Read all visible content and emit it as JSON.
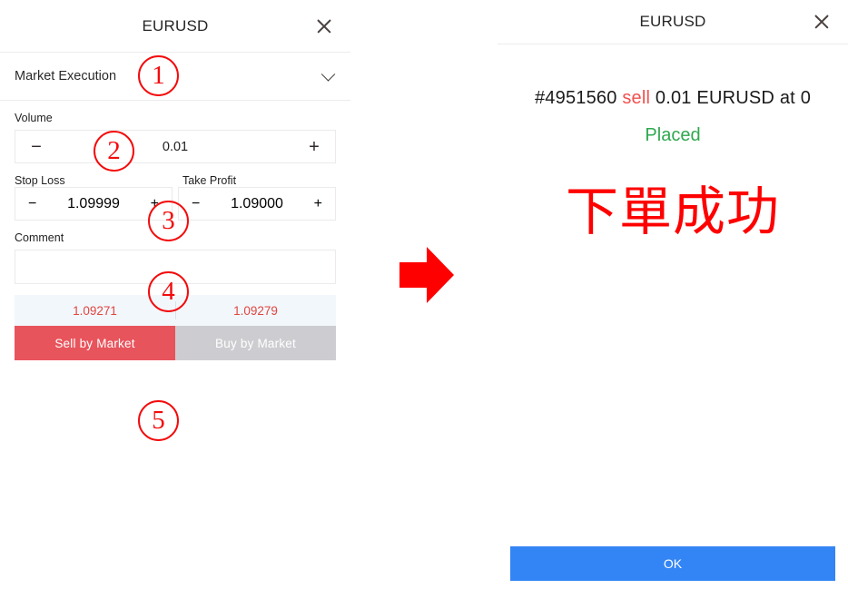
{
  "order_ticket": {
    "title": "EURUSD",
    "close_icon": "close-icon",
    "execution_mode": "Market Execution",
    "dropdown_icon": "chevron-down-icon",
    "volume": {
      "label": "Volume",
      "value": "0.01",
      "decrement": "−",
      "increment": "+"
    },
    "stop_loss": {
      "label": "Stop Loss",
      "value": "1.09999",
      "decrement": "−",
      "increment": "+",
      "color": "#e03b35"
    },
    "take_profit": {
      "label": "Take Profit",
      "value": "1.09000",
      "decrement": "−",
      "increment": "+",
      "color": "#16a64a"
    },
    "comment": {
      "label": "Comment",
      "value": "",
      "placeholder": ""
    },
    "quotes": {
      "bid": "1.09271",
      "ask": "1.09279",
      "color": "#e0453f"
    },
    "actions": {
      "sell_label": "Sell by Market",
      "sell_color": "#e8545c",
      "buy_label": "Buy by Market",
      "buy_color": "#cdcdd1"
    }
  },
  "arrow": {
    "icon": "right-arrow-icon",
    "color": "#fe0000"
  },
  "confirmation": {
    "title": "EURUSD",
    "close_icon": "close-icon",
    "order_id": "#4951560",
    "direction": "sell",
    "direction_color": "#f2514d",
    "volume": "0.01",
    "symbol": "EURUSD",
    "at_text": "at",
    "price": "0",
    "status": "Placed",
    "status_color": "#2fa84f",
    "annotation_text": "下單成功",
    "annotation_color": "#fe0000",
    "ok_label": "OK",
    "ok_color": "#3385f5"
  },
  "annotations": [
    {
      "label": "①",
      "digit": "1"
    },
    {
      "label": "②",
      "digit": "2"
    },
    {
      "label": "③",
      "digit": "3"
    },
    {
      "label": "④",
      "digit": "4"
    },
    {
      "label": "⑤",
      "digit": "5"
    }
  ]
}
